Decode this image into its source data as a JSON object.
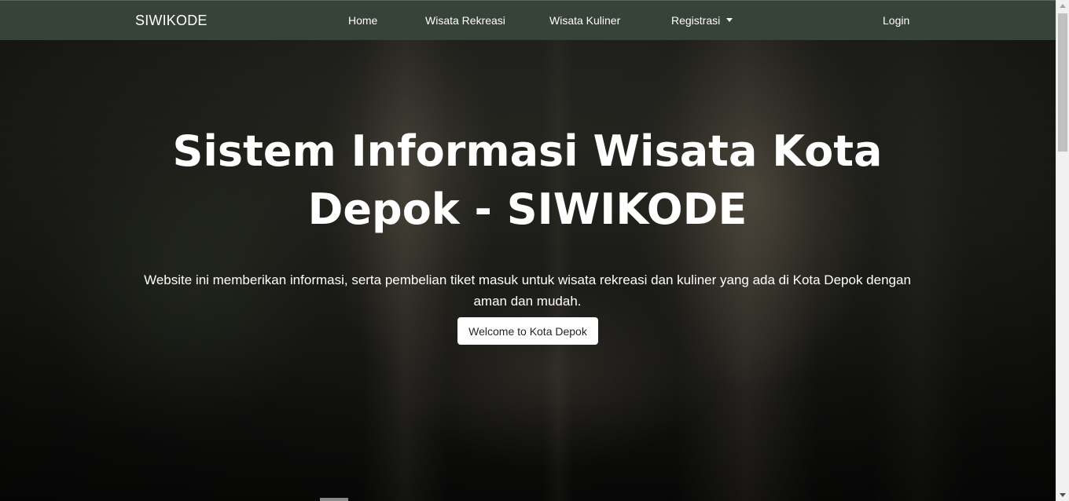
{
  "navbar": {
    "brand": "SIWIKODE",
    "links": [
      {
        "label": "Home"
      },
      {
        "label": "Wisata Rekreasi"
      },
      {
        "label": "Wisata Kuliner"
      },
      {
        "label": "Registrasi",
        "icon": "caret-down-icon"
      }
    ],
    "login": "Login"
  },
  "hero": {
    "title": "Sistem Informasi Wisata Kota Depok - SIWIKODE",
    "description": "Website ini memberikan informasi, serta pembelian tiket masuk untuk wisata rekreasi dan kuliner yang ada di Kota Depok dengan aman dan mudah.",
    "button_label": "Welcome to Kota Depok"
  },
  "colors": {
    "navbar_bg": "#374239",
    "text": "#ffffff",
    "button_bg": "#ffffff"
  }
}
